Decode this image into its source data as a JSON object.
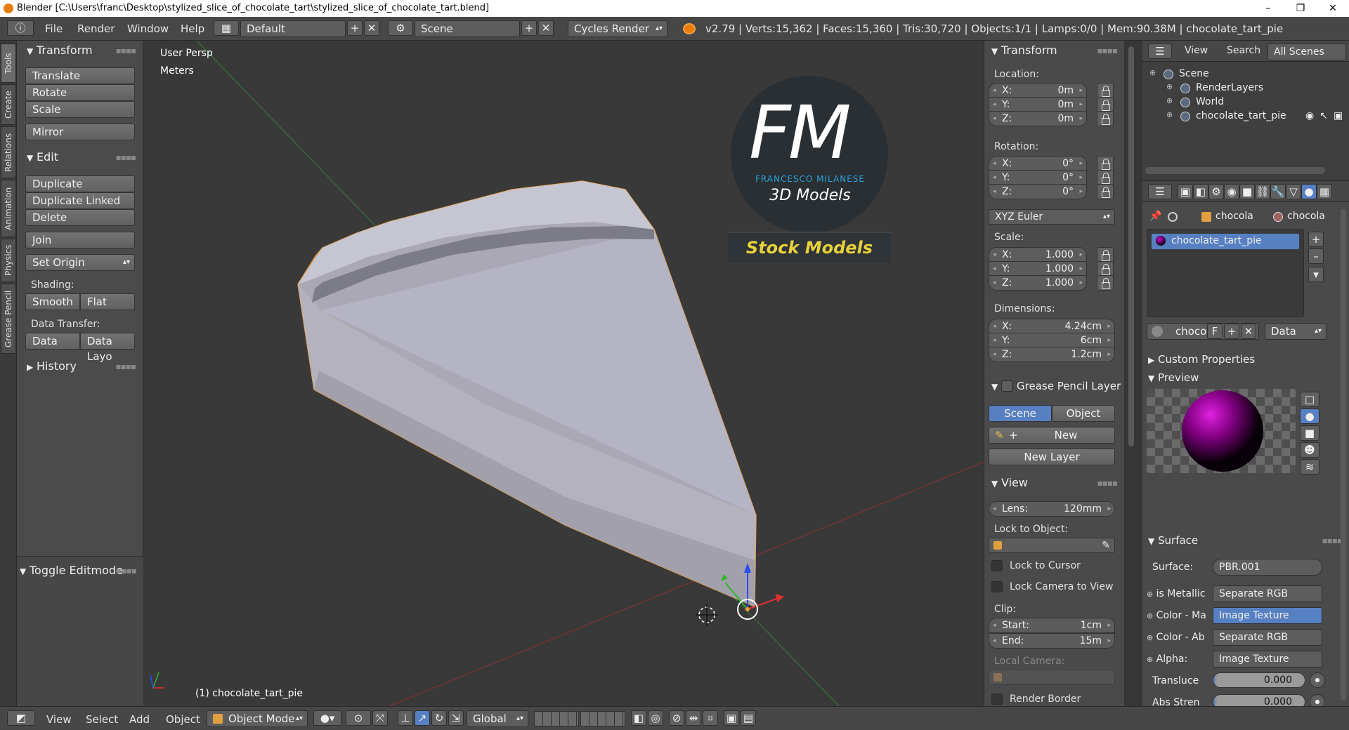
{
  "window": {
    "title": "Blender [C:\\Users\\franc\\Desktop\\stylized_slice_of_chocolate_tart\\stylized_slice_of_chocolate_tart.blend]",
    "controls": {
      "minimize": "–",
      "maximize": "❐",
      "close": "✕"
    }
  },
  "infobar": {
    "menus": [
      "File",
      "Render",
      "Window",
      "Help"
    ],
    "layout": "Default",
    "scene": "Scene",
    "engine": "Cycles Render",
    "stats": "v2.79 | Verts:15,362 | Faces:15,360 | Tris:30,720 | Objects:1/1 | Lamps:0/0 | Mem:90.38M | chocolate_tart_pie"
  },
  "vtabs": [
    "Tools",
    "Create",
    "Relations",
    "Animation",
    "Physics",
    "Grease Pencil"
  ],
  "toolshelf": {
    "transform_header": "Transform",
    "translate": "Translate",
    "rotate": "Rotate",
    "scale": "Scale",
    "mirror": "Mirror",
    "edit_header": "Edit",
    "duplicate": "Duplicate",
    "duplicate_linked": "Duplicate Linked",
    "delete": "Delete",
    "join": "Join",
    "set_origin": "Set Origin",
    "shading_label": "Shading:",
    "smooth": "Smooth",
    "flat": "Flat",
    "data_transfer_label": "Data Transfer:",
    "data": "Data",
    "data_layout": "Data Layo",
    "history_header": "History",
    "toggle_editmode": "Toggle Editmode"
  },
  "viewport": {
    "view_name": "User Persp",
    "units": "Meters",
    "object_label": "(1) chocolate_tart_pie",
    "logo_letters": "FM",
    "logo_name": "FRANCESCO MILANESE",
    "logo_sub": "3D Models",
    "logo_banner": "Stock Models"
  },
  "npanel": {
    "transform_header": "Transform",
    "location_label": "Location:",
    "location": [
      {
        "k": "X:",
        "v": "0m"
      },
      {
        "k": "Y:",
        "v": "0m"
      },
      {
        "k": "Z:",
        "v": "0m"
      }
    ],
    "rotation_label": "Rotation:",
    "rotation": [
      {
        "k": "X:",
        "v": "0°"
      },
      {
        "k": "Y:",
        "v": "0°"
      },
      {
        "k": "Z:",
        "v": "0°"
      }
    ],
    "rotation_mode": "XYZ Euler",
    "scale_label": "Scale:",
    "scale": [
      {
        "k": "X:",
        "v": "1.000"
      },
      {
        "k": "Y:",
        "v": "1.000"
      },
      {
        "k": "Z:",
        "v": "1.000"
      }
    ],
    "dimensions_label": "Dimensions:",
    "dimensions": [
      {
        "k": "X:",
        "v": "4.24cm"
      },
      {
        "k": "Y:",
        "v": "6cm"
      },
      {
        "k": "Z:",
        "v": "1.2cm"
      }
    ],
    "grease_header": "Grease Pencil Layer",
    "scene_tab": "Scene",
    "object_tab": "Object",
    "new": "New",
    "new_layer": "New Layer",
    "view_header": "View",
    "lens_label": "Lens:",
    "lens": "120mm",
    "lock_to_object": "Lock to Object:",
    "lock_cursor": "Lock to Cursor",
    "lock_camera": "Lock Camera to View",
    "clip_label": "Clip:",
    "clip_start_label": "Start:",
    "clip_start": "1cm",
    "clip_end_label": "End:",
    "clip_end": "15m",
    "local_camera": "Local Camera:",
    "render_border": "Render Border"
  },
  "outliner": {
    "view": "View",
    "search": "Search",
    "filter": "All Scenes",
    "tree": [
      {
        "name": "Scene",
        "indent": 0
      },
      {
        "name": "RenderLayers",
        "indent": 1
      },
      {
        "name": "World",
        "indent": 1
      },
      {
        "name": "chocolate_tart_pie",
        "indent": 1
      }
    ]
  },
  "properties": {
    "crumb1": "chocola",
    "crumb2": "chocola",
    "material_slot": "chocolate_tart_pie",
    "mat_name": "choco",
    "fake_user": "F",
    "data_select": "Data",
    "custom_props": "Custom Properties",
    "preview": "Preview",
    "surface_header": "Surface",
    "surface_label": "Surface:",
    "surface_value": "PBR.001",
    "inputs": [
      {
        "label": "is Metallic",
        "value": "Separate RGB",
        "active": false
      },
      {
        "label": "Color - Ma",
        "value": "Image Texture",
        "active": true
      },
      {
        "label": "Color - Ab",
        "value": "Separate RGB",
        "active": false
      },
      {
        "label": "Alpha:",
        "value": "Image Texture",
        "active": false
      }
    ],
    "sliders": [
      {
        "label": "Transluce",
        "value": "0.000"
      },
      {
        "label": "Abs Stren",
        "value": "0.000"
      }
    ]
  },
  "bottombar": {
    "menus": [
      "View",
      "Select",
      "Add",
      "Object"
    ],
    "mode": "Object Mode",
    "orientation": "Global"
  },
  "colors": {
    "accent": "#5680c2",
    "selection_outline": "#e8a040",
    "logo_blue": "#2aa0d8",
    "banner_text": "#e8d23a"
  }
}
